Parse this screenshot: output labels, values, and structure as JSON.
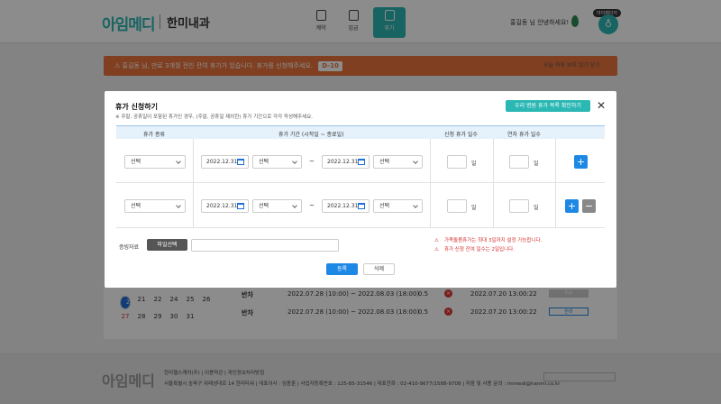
{
  "header": {
    "logo": "아임메디",
    "clinic": "한미내과",
    "nav": [
      {
        "label": "계약",
        "icon": "document-icon"
      },
      {
        "label": "임금",
        "icon": "calculator-icon"
      },
      {
        "label": "휴가",
        "icon": "vacation-icon"
      }
    ],
    "greeting": "홍길동 님 안녕하세요!",
    "avatar_badge": "마이페이지",
    "avatar_text": "♁"
  },
  "alert": {
    "icon": "⚠",
    "text": "홍길동 님, 만료 3개월 전인 잔여 휴가가 있습니다. 휴가를 신청해주세요.",
    "dday": "D-10",
    "links": "오늘 하루 보지 않기  닫기"
  },
  "background": {
    "cal_row1": [
      "20",
      "21",
      "22",
      "23",
      "24",
      "25",
      "26"
    ],
    "cal_row2": [
      "27",
      "28",
      "29",
      "30",
      "31"
    ],
    "rows": [
      {
        "type": "반차",
        "period": "2022.07.28 (10:00) ~ 2022.08.03 (18:00)",
        "days": "0.5",
        "date": "2022.07.20 13:00:22",
        "status": "취소"
      },
      {
        "type": "반차",
        "period": "2022.07.28 (10:00) ~ 2022.08.03 (18:00)",
        "days": "0.5",
        "date": "2022.07.20 13:00:22",
        "status": "반려"
      }
    ]
  },
  "modal": {
    "title": "휴가 신청하기",
    "subtitle": "※ 주말, 공휴일이 포함된 휴가인 경우, (주말, 공휴일 제외한) 휴가 기간으로 각각 작성해주세요.",
    "list_button": "우리 병원 휴가 목록 확인하기",
    "close": "✕",
    "columns": [
      "휴가 종류",
      "휴가 기간 (시작일 ~ 종료일)",
      "신청 휴가 일수",
      "연차 휴가 일수"
    ],
    "rows": [
      {
        "type_select": "선택",
        "start_date": "2022.12.31",
        "start_select": "선택",
        "tilde": "~",
        "end_date": "2022.12.31",
        "end_select": "선택",
        "unit1": "일",
        "unit2": "일"
      },
      {
        "type_select": "선택",
        "start_date": "2022.12.31",
        "start_select": "선택",
        "tilde": "~",
        "end_date": "2022.12.31",
        "end_select": "선택",
        "unit1": "일",
        "unit2": "일"
      }
    ],
    "plus": "+",
    "minus": "−",
    "file_label": "증빙자료",
    "file_button": "파일선택",
    "warnings": [
      "가족돌봄휴가는 최대 3일까지 설정 가능합니다.",
      "휴가 신청 잔여 일수는 2일입니다."
    ],
    "submit": "등록",
    "delete": "삭제"
  },
  "footer": {
    "logo": "아임메디",
    "line1": "한미헬스케어(주)  |  이용약관  |  개인정보처리방침",
    "line2": "서울특별시 송파구 위례성대로 14 한미타워  |  대표이사 : 임종훈  |  사업자등록번호 : 125-85-31546  |  대표전화 : 02-410-9677/1588-9708  |  자람 및 사용 문의 : immedi@hanmi.co.kr"
  }
}
